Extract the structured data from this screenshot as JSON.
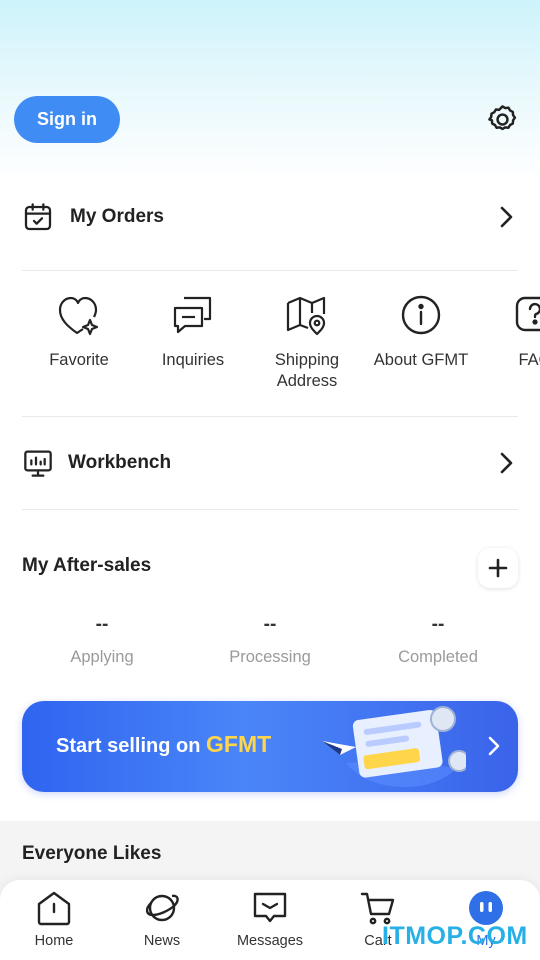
{
  "header": {
    "signin_label": "Sign in"
  },
  "orders": {
    "label": "My Orders"
  },
  "shortcuts": [
    {
      "label": "Favorite",
      "icon": "heart-sparkle-icon"
    },
    {
      "label": "Inquiries",
      "icon": "chat-bubbles-icon"
    },
    {
      "label": "Shipping\nAddress",
      "icon": "map-pin-icon"
    },
    {
      "label": "About GFMT",
      "icon": "info-circle-icon"
    },
    {
      "label": "FAQ",
      "icon": "question-icon"
    }
  ],
  "workbench": {
    "label": "Workbench"
  },
  "after_sales": {
    "title": "My After-sales",
    "stats": [
      {
        "value": "--",
        "label": "Applying"
      },
      {
        "value": "--",
        "label": "Processing"
      },
      {
        "value": "--",
        "label": "Completed"
      }
    ]
  },
  "banner": {
    "text": "Start selling on",
    "brand": "GFMT"
  },
  "likes": {
    "title": "Everyone Likes"
  },
  "tabs": [
    {
      "label": "Home",
      "icon": "home-icon"
    },
    {
      "label": "News",
      "icon": "planet-icon"
    },
    {
      "label": "Messages",
      "icon": "message-icon"
    },
    {
      "label": "Cart",
      "icon": "cart-icon"
    },
    {
      "label": "My",
      "icon": "robot-avatar-icon",
      "active": true
    }
  ],
  "watermark": "ITMOP.COM",
  "colors": {
    "accent": "#3f8cf4",
    "active_tab": "#2f6fe8",
    "brand_yellow": "#ffd54a"
  }
}
